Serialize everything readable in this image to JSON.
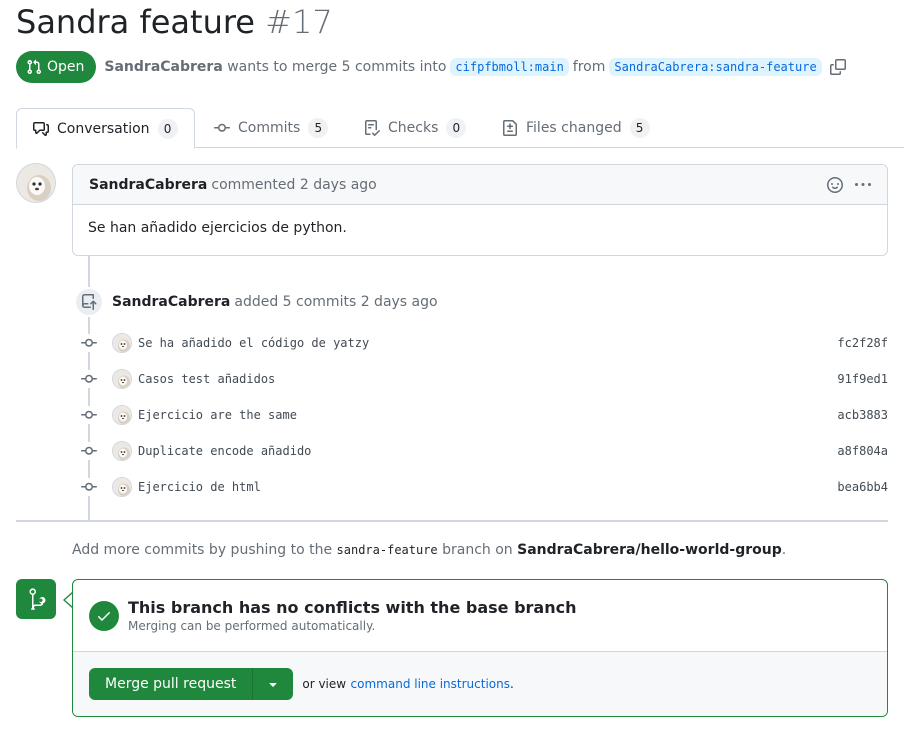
{
  "pr": {
    "title": "Sandra feature",
    "number": "#17",
    "state": "Open",
    "author": "SandraCabrera",
    "action_text": "wants to merge 5 commits into",
    "base_branch": "cifpfbmoll:main",
    "from_text": "from",
    "head_branch": "SandraCabrera:sandra-feature"
  },
  "tabs": [
    {
      "label": "Conversation",
      "count": "0"
    },
    {
      "label": "Commits",
      "count": "5"
    },
    {
      "label": "Checks",
      "count": "0"
    },
    {
      "label": "Files changed",
      "count": "5"
    }
  ],
  "comment": {
    "author": "SandraCabrera",
    "action": "commented 2 days ago",
    "body": "Se han añadido ejercicios de python."
  },
  "commit_event": {
    "author": "SandraCabrera",
    "action": "added 5 commits 2 days ago"
  },
  "commits": [
    {
      "message": "Se ha añadido el código de yatzy",
      "sha": "fc2f28f"
    },
    {
      "message": "Casos test añadidos",
      "sha": "91f9ed1"
    },
    {
      "message": "Ejercicio are the same",
      "sha": "acb3883"
    },
    {
      "message": "Duplicate encode añadido",
      "sha": "a8f804a"
    },
    {
      "message": "Ejercicio de html",
      "sha": "bea6bb4"
    }
  ],
  "push_hint": {
    "prefix": "Add more commits by pushing to the",
    "branch": "sandra-feature",
    "middle": "branch on",
    "repo": "SandraCabrera/hello-world-group",
    "suffix": "."
  },
  "merge": {
    "heading": "This branch has no conflicts with the base branch",
    "subtext": "Merging can be performed automatically.",
    "button_label": "Merge pull request",
    "or_text": "or view",
    "link_text": "command line instructions",
    "link_suffix": "."
  },
  "colors": {
    "success": "#1f883d",
    "link": "#0969da",
    "muted": "#656d76",
    "border": "#d0d7de"
  }
}
